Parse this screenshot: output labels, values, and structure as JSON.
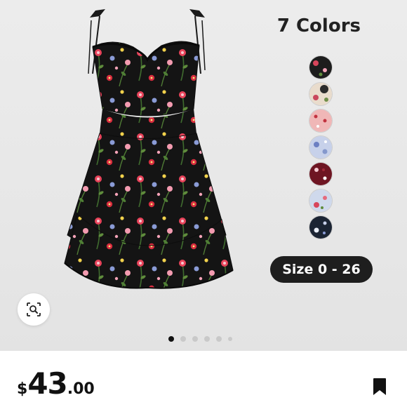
{
  "colors": {
    "accent": "#1e1e1e",
    "pill_text": "#ffffff",
    "dress_base": "#131313"
  },
  "product": {
    "image_alt": "floral-black-mini-dress",
    "colors_label": "7 Colors",
    "size_badge": "Size 0 - 26",
    "swatches": [
      {
        "name": "black floral",
        "color": "#1d1d1d"
      },
      {
        "name": "cream floral",
        "color": "#e9dccc"
      },
      {
        "name": "pink floral",
        "color": "#f0b7b7"
      },
      {
        "name": "blue floral",
        "color": "#c7d1ea"
      },
      {
        "name": "burgundy floral",
        "color": "#6e1522"
      },
      {
        "name": "light blue floral",
        "color": "#cfd9ec"
      },
      {
        "name": "navy floral",
        "color": "#1b2433"
      }
    ],
    "gallery": {
      "page_count": 6,
      "current": 1
    }
  },
  "price": {
    "currency": "$",
    "main": "43",
    "cents": ".00"
  },
  "icons": {
    "lens": "visual-search-icon",
    "save": "bookmark-icon"
  }
}
